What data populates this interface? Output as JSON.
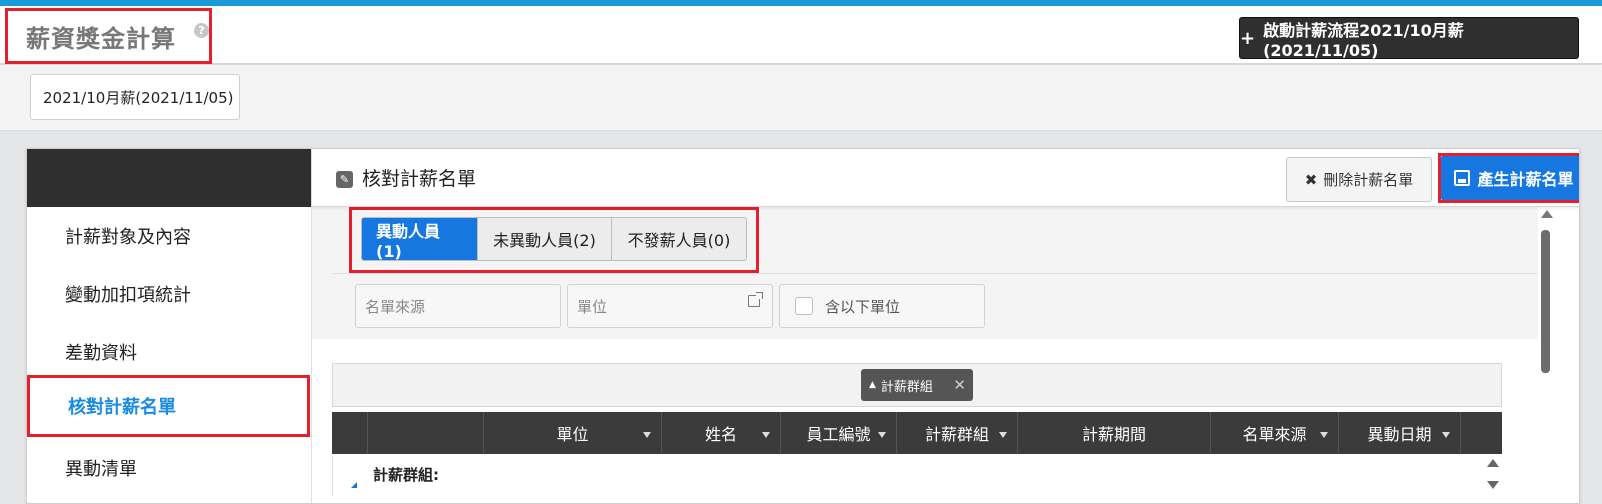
{
  "header": {
    "title": "薪資獎金計算",
    "help_glyph": "?",
    "start_button_plus": "+",
    "start_button_label": "啟動計薪流程2021/10月薪(2021/11/05)"
  },
  "period_tabs": [
    {
      "label": "2021/10月薪(2021/11/05)"
    }
  ],
  "sidebar": {
    "items": [
      {
        "label": "計薪對象及內容"
      },
      {
        "label": "變動加扣項統計"
      },
      {
        "label": "差勤資料"
      },
      {
        "label": "核對計薪名單",
        "active": true
      },
      {
        "label": "異動清單"
      }
    ]
  },
  "main": {
    "title": "核對計薪名單",
    "delete_button_label": "刪除計薪名單",
    "delete_glyph": "✖",
    "generate_button_label": "產生計薪名單",
    "tabs": [
      {
        "label": "異動人員(1)",
        "active": true
      },
      {
        "label": "未異動人員(2)"
      },
      {
        "label": "不發薪人員(0)"
      }
    ],
    "filters": {
      "source_placeholder": "名單來源",
      "unit_placeholder": "單位",
      "include_sub_label": "含以下單位"
    },
    "group_chip": {
      "label": "計薪群組",
      "arrow": "▲",
      "close": "✕"
    },
    "columns": [
      "",
      "",
      "單位",
      "姓名",
      "員工編號",
      "計薪群組",
      "計薪期間",
      "名單來源",
      "異動日期",
      ""
    ],
    "group_row_label": "計薪群組:"
  },
  "colors": {
    "accent": "#1a9ad6",
    "primary_button": "#1677e0",
    "highlight_border": "#e5202e",
    "dark_bar": "#2f2f2f"
  }
}
